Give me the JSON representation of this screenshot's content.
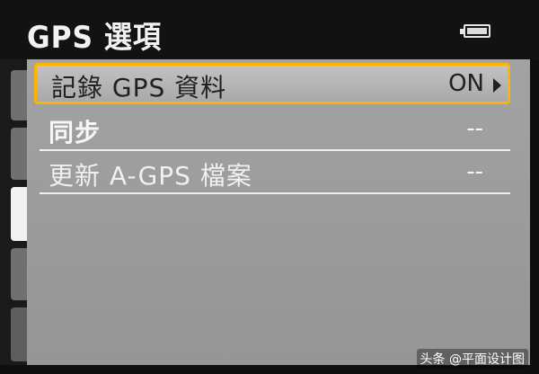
{
  "header": {
    "title": "GPS 選項"
  },
  "menu": {
    "items": [
      {
        "label": "記錄 GPS 資料",
        "value": "ON"
      },
      {
        "label": "同步",
        "value": "--"
      },
      {
        "label": "更新 A-GPS 檔案",
        "value": "--"
      }
    ]
  },
  "watermark": {
    "text": "头条 @平面设计图"
  },
  "colors": {
    "selection": "#ffb400",
    "panel": "#9e9e9e",
    "background": "#121212"
  },
  "icons": {
    "battery": "battery-icon",
    "submenu": "chevron-right-icon"
  }
}
